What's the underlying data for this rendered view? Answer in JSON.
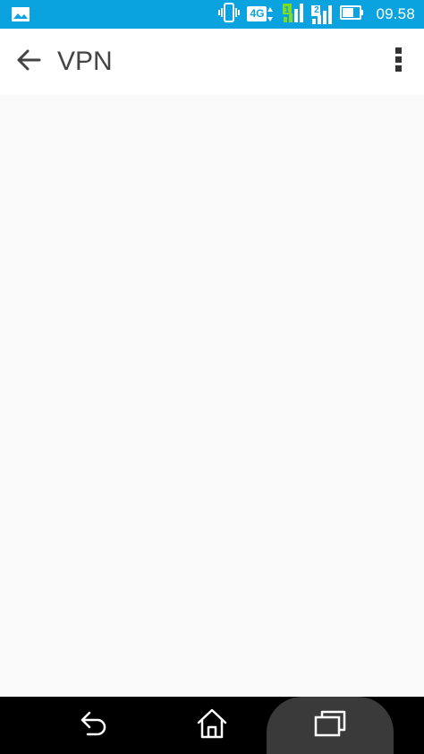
{
  "status_bar": {
    "time": "09.58",
    "network_label": "4G",
    "sim2_label": "2",
    "icons": [
      "gallery-notification-icon",
      "vibrate-icon",
      "4g-data-icon",
      "signal-sim1-icon",
      "signal-sim2-icon",
      "battery-icon"
    ],
    "background_color": "#0aa3e0",
    "signal_accent_color": "#7ddc1f"
  },
  "app_bar": {
    "title": "VPN",
    "back_icon": "arrow-left-icon",
    "menu_icon": "more-vertical-icon"
  },
  "nav_bar": {
    "icons": [
      "nav-back-icon",
      "nav-home-icon",
      "nav-recents-icon"
    ]
  }
}
